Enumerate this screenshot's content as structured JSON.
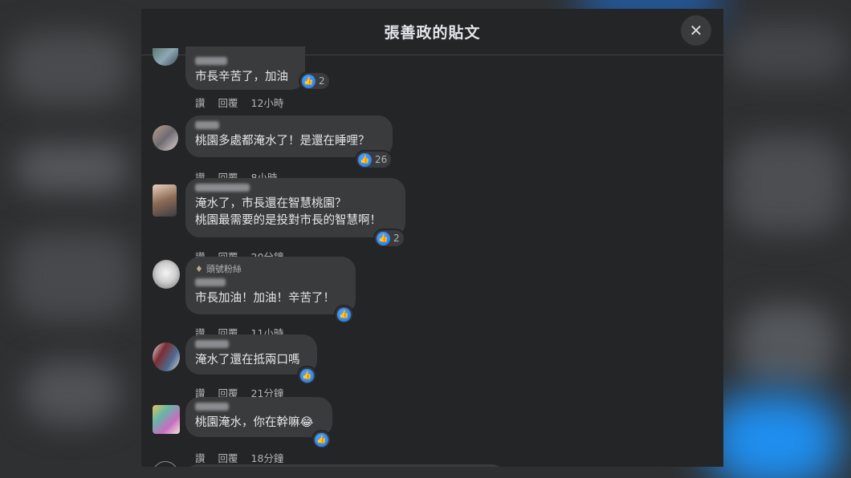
{
  "dialog": {
    "title": "張善政的貼文",
    "close_icon": "close-icon"
  },
  "comments": [
    {
      "text": "市長辛苦了，加油",
      "likes": "2",
      "like_label": "讚",
      "reply_label": "回覆",
      "time": "12小時"
    },
    {
      "text": "桃園多處都淹水了！是還在睡哩？",
      "likes": "26",
      "like_label": "讚",
      "reply_label": "回覆",
      "time": "8小時"
    },
    {
      "text": "淹水了，市長還在智慧桃園？\n桃園最需要的是投對市長的智慧啊！",
      "likes": "2",
      "like_label": "讚",
      "reply_label": "回覆",
      "time": "20分鐘"
    },
    {
      "badge": "頭號粉絲",
      "text": "市長加油！加油！辛苦了！",
      "likes": "",
      "like_label": "讚",
      "reply_label": "回覆",
      "time": "11小時"
    },
    {
      "text": "淹水了還在抵兩口嗎",
      "likes": "",
      "like_label": "讚",
      "reply_label": "回覆",
      "time": "21分鐘"
    },
    {
      "text": "桃園淹水，你在幹嘛😂",
      "likes": "",
      "like_label": "讚",
      "reply_label": "回覆",
      "time": "18分鐘"
    }
  ],
  "colors": {
    "like": "#1877f2",
    "bubble": "#3a3b3c",
    "panel": "#242526"
  }
}
